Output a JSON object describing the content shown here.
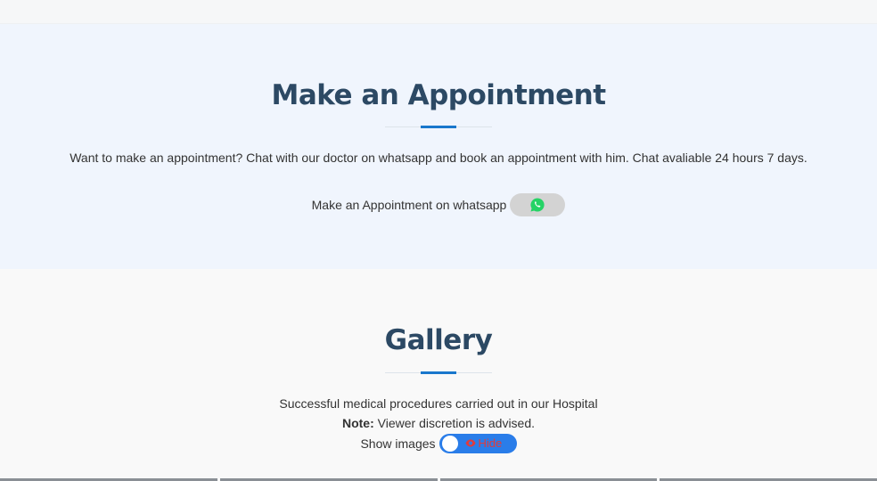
{
  "appointment": {
    "title": "Make an Appointment",
    "description": "Want to make an appointment? Chat with our doctor on whatsapp and book an appointment with him. Chat avaliable 24 hours 7 days.",
    "whatsapp_label": "Make an Appointment on whatsapp",
    "whatsapp_icon": "whatsapp-icon",
    "whatsapp_button_color": "#d3d3d3",
    "whatsapp_icon_color": "#25d366"
  },
  "gallery": {
    "title": "Gallery",
    "line1": "Successful medical procedures carried out in our Hospital",
    "note_label": "Note:",
    "note_text": " Viewer discretion is advised.",
    "show_images_label": "Show images",
    "toggle_label": "Hide",
    "toggle_icon": "eye-icon",
    "toggle_color": "#2a7de9",
    "toggle_label_color": "#e23b3b"
  },
  "colors": {
    "heading": "#2c4964",
    "accent": "#1977cc",
    "appointment_bg": "#f0f5fd"
  }
}
